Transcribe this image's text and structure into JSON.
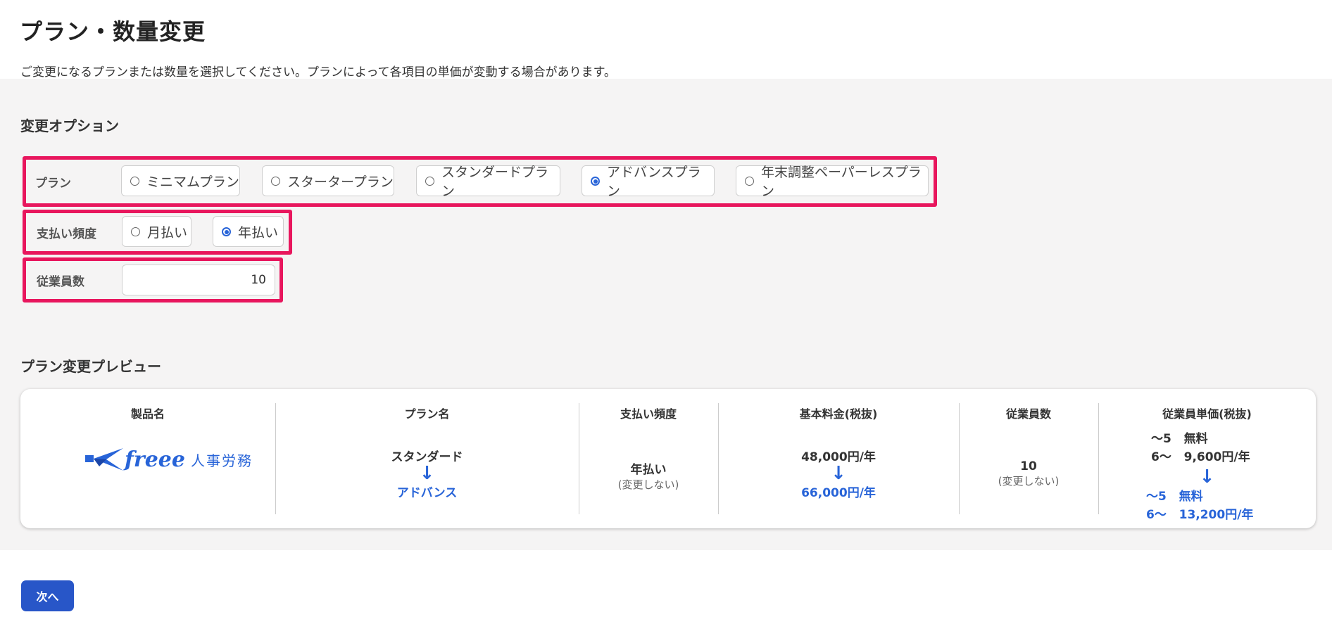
{
  "page": {
    "title": "プラン・数量変更",
    "description": "ご変更になるプランまたは数量を選択してください。プランによって各項目の単価が変動する場合があります。"
  },
  "options": {
    "heading": "変更オプション",
    "plan_label": "プラン",
    "plans": [
      {
        "label": "ミニマムプラン",
        "checked": false
      },
      {
        "label": "スタータープラン",
        "checked": false
      },
      {
        "label": "スタンダードプラン",
        "checked": false
      },
      {
        "label": "アドバンスプラン",
        "checked": true
      },
      {
        "label": "年末調整ペーパーレスプラン",
        "checked": false
      }
    ],
    "frequency_label": "支払い頻度",
    "frequencies": [
      {
        "label": "月払い",
        "checked": false
      },
      {
        "label": "年払い",
        "checked": true
      }
    ],
    "employees_label": "従業員数",
    "employees_value": "10"
  },
  "preview": {
    "heading": "プラン変更プレビュー",
    "columns": {
      "product": "製品名",
      "plan": "プラン名",
      "frequency": "支払い頻度",
      "base_fee": "基本料金(税抜)",
      "employees": "従業員数",
      "unit_price": "従業員単価(税抜)"
    },
    "product_logo": {
      "script": "freee",
      "text": "人事労務",
      "icon": "paper-plane-icon"
    },
    "plan_old": "スタンダード",
    "plan_new": "アドバンス",
    "frequency_value": "年払い",
    "frequency_note": "(変更しない)",
    "base_fee_old": "48,000円/年",
    "base_fee_new": "66,000円/年",
    "employees_value": "10",
    "employees_note": "(変更しない)",
    "unit_old": [
      {
        "range": "〜5",
        "price": "無料"
      },
      {
        "range": "6〜",
        "price": "9,600円/年"
      }
    ],
    "unit_new": [
      {
        "range": "〜5",
        "price": "無料"
      },
      {
        "range": "6〜",
        "price": "13,200円/年"
      }
    ],
    "arrow": "↓"
  },
  "next_button": "次へ",
  "colors": {
    "accent": "#2864d8",
    "highlight": "#e8165d",
    "button": "#2856c8"
  }
}
